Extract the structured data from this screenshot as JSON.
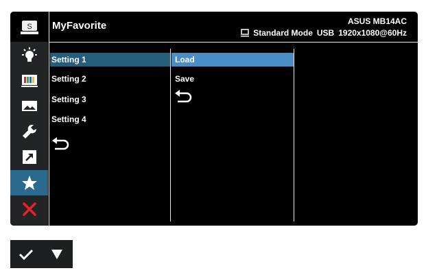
{
  "header": {
    "title": "MyFavorite",
    "model": "ASUS MB14AC",
    "mode": "Standard Mode",
    "input": "USB",
    "resolution": "1920x1080@60Hz"
  },
  "sidebar": {
    "items": [
      {
        "icon": "s-logo-icon"
      },
      {
        "icon": "lightbulb-icon"
      },
      {
        "icon": "color-bars-icon"
      },
      {
        "icon": "image-icon"
      },
      {
        "icon": "wrench-icon"
      },
      {
        "icon": "shortcut-arrow-icon"
      },
      {
        "icon": "star-icon",
        "active": true
      },
      {
        "icon": "close-icon"
      }
    ]
  },
  "menu": {
    "settings": [
      "Setting 1",
      "Setting 2",
      "Setting 3",
      "Setting 4"
    ],
    "actions": [
      "Load",
      "Save"
    ]
  },
  "colors": {
    "selected_setting": "#255e7c",
    "selected_action": "#4a8ec8",
    "active_tab": "#2a6a8e",
    "close_red": "#e8202a"
  },
  "bottom_buttons": [
    {
      "icon": "checkmark-icon"
    },
    {
      "icon": "down-triangle-icon"
    }
  ]
}
